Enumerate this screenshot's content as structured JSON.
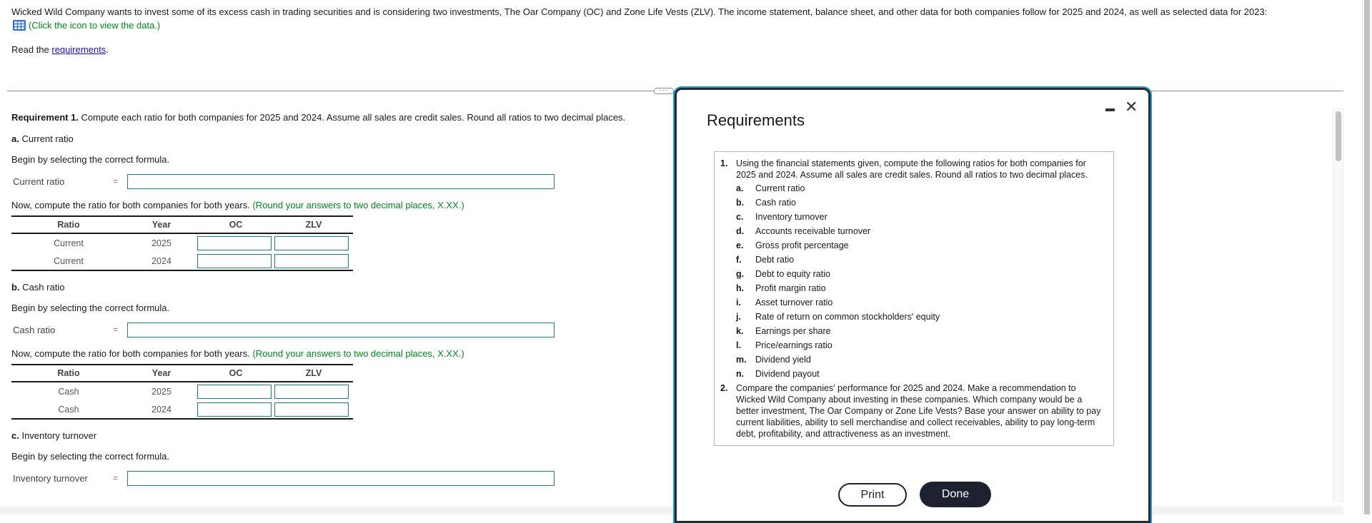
{
  "intro": {
    "text": "Wicked Wild Company wants to invest some of its excess cash in trading securities and is considering two investments, The Oar Company (OC) and Zone Life Vests (ZLV). The income statement, balance sheet, and other data for both companies follow for 2025 and 2024, as well as selected data for 2023:",
    "data_link": "(Click the icon to view the data.)",
    "data_icon": "table-grid-icon",
    "read_prefix": "Read the ",
    "read_link": "requirements",
    "read_suffix": "."
  },
  "splitter": {
    "handle_label": "···"
  },
  "requirement1": {
    "bold": "Requirement 1.",
    "text": " Compute each ratio for both companies for 2025 and 2024. Assume all sales are credit sales. Round all ratios to two decimal places."
  },
  "sections": [
    {
      "letter": "a.",
      "title": " Current ratio",
      "begin": "Begin by selecting the correct formula.",
      "formula_label": "Current ratio",
      "equals": "=",
      "formula_value": "",
      "now": "Now, compute the ratio for both companies for both years.",
      "hint": "(Round your answers to two decimal places, X.XX.)",
      "table": {
        "headers": [
          "Ratio",
          "Year",
          "OC",
          "ZLV"
        ],
        "rows": [
          {
            "ratio": "Current",
            "year": "2025",
            "oc": "",
            "zlv": ""
          },
          {
            "ratio": "Current",
            "year": "2024",
            "oc": "",
            "zlv": ""
          }
        ]
      }
    },
    {
      "letter": "b.",
      "title": " Cash ratio",
      "begin": "Begin by selecting the correct formula.",
      "formula_label": "Cash ratio",
      "equals": "=",
      "formula_value": "",
      "now": "Now, compute the ratio for both companies for both years.",
      "hint": "(Round your answers to two decimal places, X.XX.)",
      "table": {
        "headers": [
          "Ratio",
          "Year",
          "OC",
          "ZLV"
        ],
        "rows": [
          {
            "ratio": "Cash",
            "year": "2025",
            "oc": "",
            "zlv": ""
          },
          {
            "ratio": "Cash",
            "year": "2024",
            "oc": "",
            "zlv": ""
          }
        ]
      }
    },
    {
      "letter": "c.",
      "title": " Inventory turnover",
      "begin": "Begin by selecting the correct formula.",
      "formula_label": "Inventory turnover",
      "equals": "=",
      "formula_value": ""
    }
  ],
  "dialog": {
    "title": "Requirements",
    "minimize_icon": "minimize-icon",
    "close_icon": "close-icon",
    "close_glyph": "✕",
    "items": [
      {
        "num": "1.",
        "text": "Using the financial statements given, compute the following ratios for both companies for 2025 and 2024. Assume all sales are credit sales. Round all ratios to two decimal places.",
        "sub": [
          {
            "letter": "a.",
            "text": "Current ratio"
          },
          {
            "letter": "b.",
            "text": "Cash ratio"
          },
          {
            "letter": "c.",
            "text": "Inventory turnover"
          },
          {
            "letter": "d.",
            "text": "Accounts receivable turnover"
          },
          {
            "letter": "e.",
            "text": "Gross profit percentage"
          },
          {
            "letter": "f.",
            "text": "Debt ratio"
          },
          {
            "letter": "g.",
            "text": "Debt to equity ratio"
          },
          {
            "letter": "h.",
            "text": "Profit margin ratio"
          },
          {
            "letter": "i.",
            "text": "Asset turnover ratio"
          },
          {
            "letter": "j.",
            "text": "Rate of return on common stockholders' equity"
          },
          {
            "letter": "k.",
            "text": "Earnings per share"
          },
          {
            "letter": "l.",
            "text": "Price/earnings ratio"
          },
          {
            "letter": "m.",
            "text": "Dividend yield"
          },
          {
            "letter": "n.",
            "text": "Dividend payout"
          }
        ]
      },
      {
        "num": "2.",
        "text": "Compare the companies' performance for 2025 and 2024. Make a recommendation to Wicked Wild Company about investing in these companies. Which company would be a better investment, The Oar Company or Zone Life Vests? Base your answer on ability to pay current liabilities, ability to sell merchandise and collect receivables, ability to pay long-term debt, profitability, and attractiveness as an investment."
      }
    ],
    "print_label": "Print",
    "done_label": "Done"
  },
  "colors": {
    "input_border": "#1d7a94",
    "hint_green": "#008a1c",
    "link_blue": "#1a0dcc",
    "dialog_accent": "#1a9ad6",
    "done_bg": "#1e2230"
  }
}
